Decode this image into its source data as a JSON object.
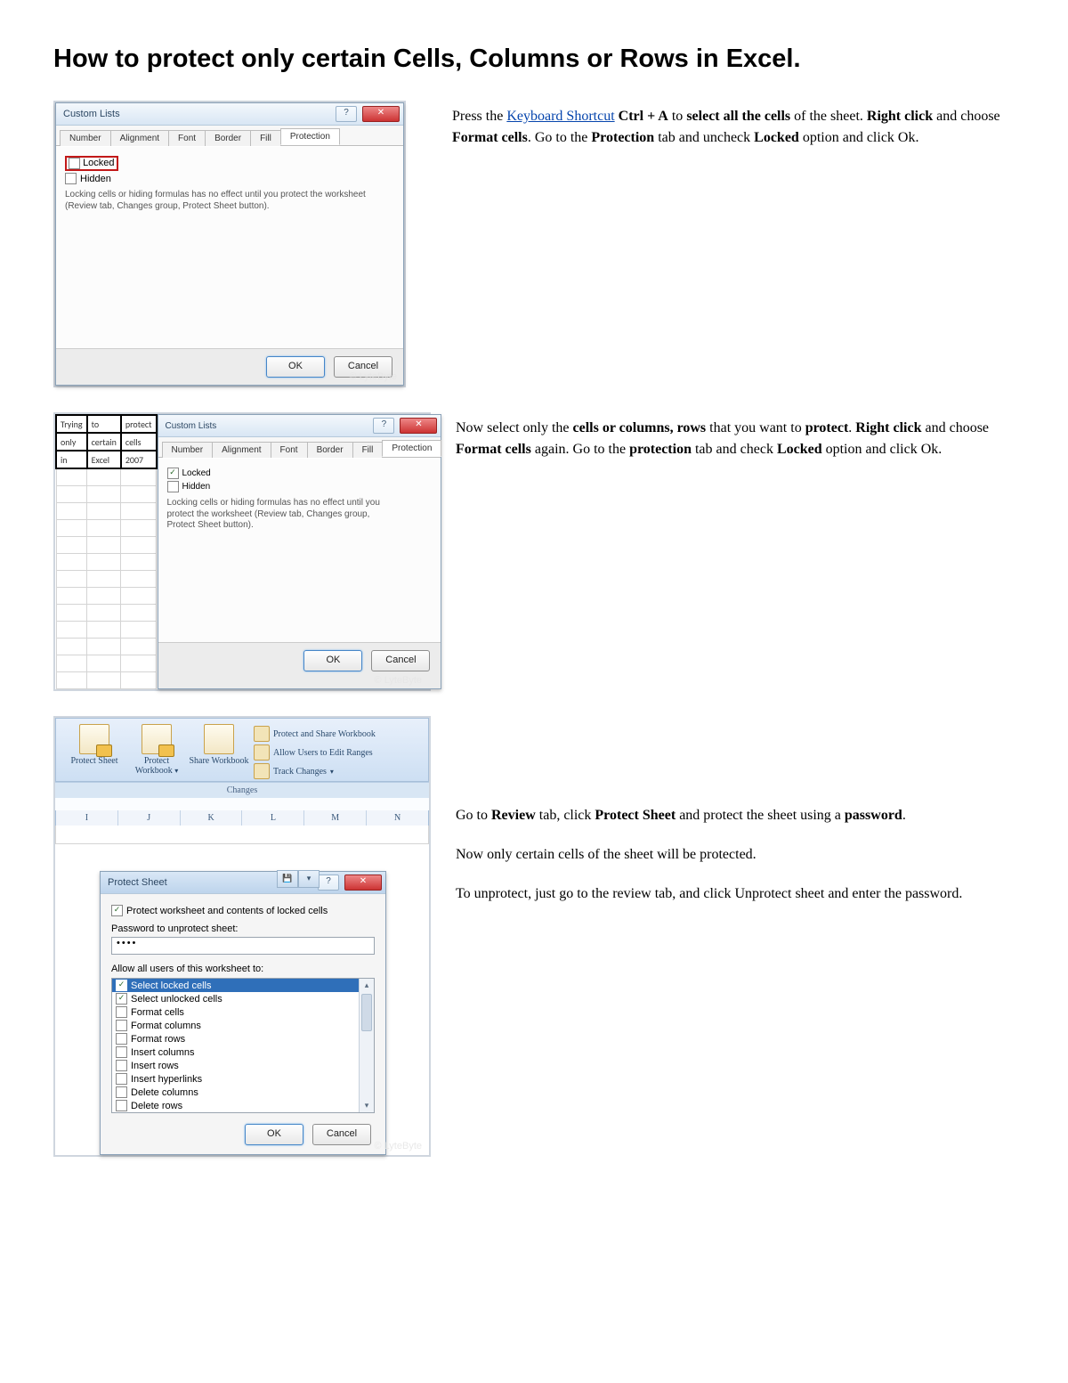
{
  "title": "How to protect only certain Cells, Columns or Rows in Excel.",
  "step1": {
    "link": "Keyboard Shortcut",
    "t1a": "Press the ",
    "t1b": " Ctrl + A",
    "t1c": " to ",
    "t1d": "select all the cells",
    "t1e": " of the sheet. ",
    "t1f": "Right click",
    "t1g": " and choose ",
    "t1h": "Format cells",
    "t1i": ". Go to the ",
    "t1j": "Protection",
    "t1k": " tab and uncheck ",
    "t1l": "Locked",
    "t1m": " option and click Ok."
  },
  "step2": {
    "a": "Now select only the ",
    "b": "cells or columns, rows",
    "c": " that you want to ",
    "d": "protect",
    "e": ". ",
    "f": "Right click",
    "g": " and choose ",
    "h": "Format cells",
    "i": " again. Go to the ",
    "j": "protection",
    "k": " tab and check ",
    "l": "Locked",
    "m": " option and click Ok."
  },
  "step3": {
    "p1a": "Go to ",
    "p1b": "Review",
    "p1c": " tab, click ",
    "p1d": "Protect Sheet",
    "p1e": " and protect the sheet using a ",
    "p1f": "password",
    "p1g": ".",
    "p2": "Now only certain cells of the sheet will be protected.",
    "p3": "To unprotect, just go to the review tab, and click Unprotect sheet and enter the password."
  },
  "dlg": {
    "title": "Custom Lists",
    "tabs": [
      "Number",
      "Alignment",
      "Font",
      "Border",
      "Fill",
      "Protection"
    ],
    "locked": "Locked",
    "hidden": "Hidden",
    "info": "Locking cells or hiding formulas has no effect until you protect the worksheet (Review tab, Changes group, Protect Sheet button).",
    "ok": "OK",
    "cancel": "Cancel"
  },
  "cells": [
    [
      "Trying",
      "to",
      "protect"
    ],
    [
      "only",
      "certain",
      "cells"
    ],
    [
      "in",
      "Excel",
      "2007"
    ]
  ],
  "ribbon": {
    "big": [
      {
        "label": "Protect Sheet"
      },
      {
        "label": "Protect Workbook",
        "drop": true
      },
      {
        "label": "Share Workbook"
      }
    ],
    "small": [
      "Protect and Share Workbook",
      "Allow Users to Edit Ranges",
      "Track Changes"
    ],
    "group": "Changes",
    "cols": [
      "I",
      "J",
      "K",
      "L",
      "M",
      "N"
    ]
  },
  "protect": {
    "title": "Protect Sheet",
    "chk1": "Protect worksheet and contents of locked cells",
    "pw_label": "Password to unprotect sheet:",
    "pw": "••••",
    "allow_label": "Allow all users of this worksheet to:",
    "items": [
      {
        "label": "Select locked cells",
        "checked": true,
        "sel": true
      },
      {
        "label": "Select unlocked cells",
        "checked": true
      },
      {
        "label": "Format cells",
        "checked": false
      },
      {
        "label": "Format columns",
        "checked": false
      },
      {
        "label": "Format rows",
        "checked": false
      },
      {
        "label": "Insert columns",
        "checked": false
      },
      {
        "label": "Insert rows",
        "checked": false
      },
      {
        "label": "Insert hyperlinks",
        "checked": false
      },
      {
        "label": "Delete columns",
        "checked": false
      },
      {
        "label": "Delete rows",
        "checked": false
      }
    ],
    "ok": "OK",
    "cancel": "Cancel"
  },
  "watermark": "© LyteByte"
}
